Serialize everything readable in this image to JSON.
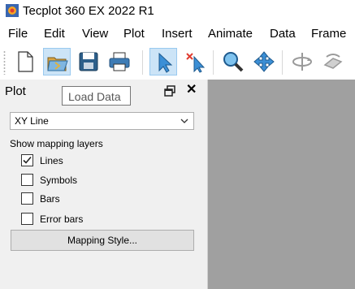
{
  "window": {
    "title": "Tecplot 360 EX 2022 R1"
  },
  "menubar": {
    "items": [
      "File",
      "Edit",
      "View",
      "Plot",
      "Insert",
      "Animate",
      "Data",
      "Frame"
    ]
  },
  "toolbar": {
    "buttons": [
      "new-layout",
      "load-data",
      "save",
      "print",
      "selector",
      "adjustor",
      "zoom",
      "translate",
      "rotate",
      "rotate-3d"
    ],
    "hovered": "load-data"
  },
  "tooltip": {
    "text": "Load Data"
  },
  "panel": {
    "title": "Plot",
    "plot_type": "XY Line",
    "section_label": "Show mapping layers",
    "layers": [
      {
        "label": "Lines",
        "checked": true
      },
      {
        "label": "Symbols",
        "checked": false
      },
      {
        "label": "Bars",
        "checked": false
      },
      {
        "label": "Error bars",
        "checked": false
      }
    ],
    "mapping_style_label": "Mapping Style..."
  },
  "colors": {
    "workspace": "#a0a0a0",
    "panel": "#f0f0f0",
    "hover": "#cce4f7"
  }
}
